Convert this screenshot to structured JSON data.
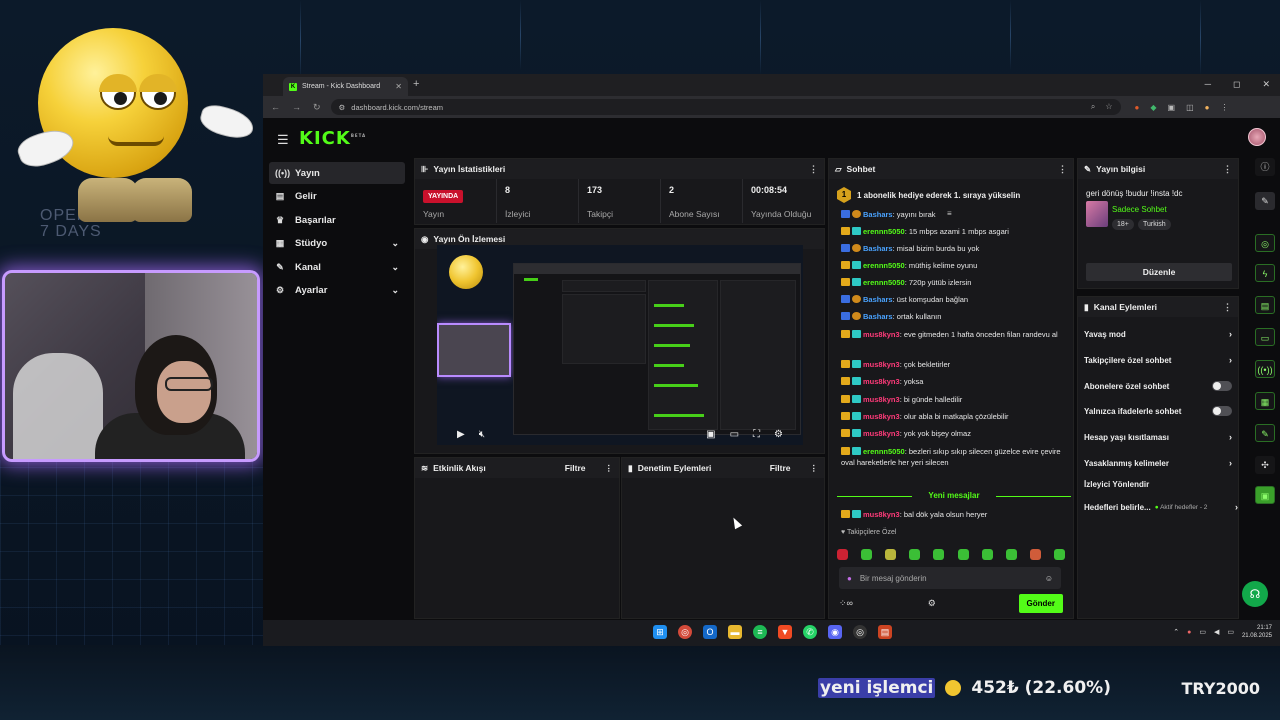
{
  "background": {
    "text": "OPEN\n7 DAYS"
  },
  "browser": {
    "tab_title": "Stream - Kick Dashboard",
    "url": "dashboard.kick.com/stream"
  },
  "app": {
    "logo": "KICK",
    "logo_badge": "BETA",
    "nav": [
      {
        "label": "Yayın",
        "icon": "broadcast-icon"
      },
      {
        "label": "Gelir",
        "icon": "wallet-icon"
      },
      {
        "label": "Başarılar",
        "icon": "trophy-icon"
      },
      {
        "label": "Stüdyo",
        "icon": "studio-icon"
      },
      {
        "label": "Kanal",
        "icon": "channel-icon"
      },
      {
        "label": "Ayarlar",
        "icon": "settings-icon"
      }
    ]
  },
  "stats_panel": {
    "title": "Yayın İstatistikleri",
    "live_badge": "YAYINDA",
    "stats": [
      {
        "value": "",
        "label": "Yayın"
      },
      {
        "value": "8",
        "label": "İzleyici"
      },
      {
        "value": "173",
        "label": "Takipçi"
      },
      {
        "value": "2",
        "label": "Abone Sayısı"
      },
      {
        "value": "00:08:54",
        "label": "Yayında Olduğu"
      }
    ]
  },
  "preview_panel": {
    "title": "Yayın Ön İzlemesi"
  },
  "activity_panel": {
    "title": "Etkinlik Akışı",
    "filter": "Filtre"
  },
  "moderation_panel": {
    "title": "Denetim Eylemleri",
    "filter": "Filtre"
  },
  "chat": {
    "title": "Sohbet",
    "pinned": "1 abonelik hediye ederek 1. sıraya yükselin",
    "pinned_number": "1",
    "messages": [
      {
        "user": "Bashars",
        "text": ": yayını bırak",
        "color": "blue"
      },
      {
        "user": "erennn5050",
        "text": ": 15 mbps azami 1 mbps asgari",
        "color": "green"
      },
      {
        "user": "Bashars",
        "text": ": misal bizim burda bu yok",
        "color": "blue"
      },
      {
        "user": "erennn5050",
        "text": ": müthiş kelime oyunu",
        "color": "green"
      },
      {
        "user": "erennn5050",
        "text": ": 720p yütüb izlersin",
        "color": "green"
      },
      {
        "user": "Bashars",
        "text": ": üst komşudan bağlan",
        "color": "blue"
      },
      {
        "user": "Bashars",
        "text": ": ortak kullanın",
        "color": "blue"
      },
      {
        "user": "mus8kyn3",
        "text": ": eve gitmeden 1 hafta önceden filan randevu al",
        "color": "red"
      },
      {
        "user": "mus8kyn3",
        "text": ": çok bekletirler",
        "color": "red"
      },
      {
        "user": "mus8kyn3",
        "text": ": yoksa",
        "color": "red"
      },
      {
        "user": "mus8kyn3",
        "text": ": bi günde halledilir",
        "color": "red"
      },
      {
        "user": "mus8kyn3",
        "text": ": olur abla bi matkapla çözülebilir",
        "color": "red"
      },
      {
        "user": "mus8kyn3",
        "text": ": yok yok bişey olmaz",
        "color": "red"
      },
      {
        "user": "erennn5050",
        "text": ": bezleri sıkıp sıkıp silecen güzelce evire çevire oval hareketlerle her yeri silecen",
        "color": "green"
      }
    ],
    "new_messages": "Yeni mesajlar",
    "last_message": {
      "user": "mus8kyn3",
      "text": ": bal dök yala olsun heryer"
    },
    "followers_only": "Takipçilere Özel",
    "input_placeholder": "Bir mesaj gönderin",
    "send": "Gönder"
  },
  "stream_info": {
    "title": "Yayın bilgisi",
    "stream_title": "geri dönüş !budur !insta !dc",
    "category": "Sadece Sohbet",
    "tags": [
      "18+",
      "Turkish"
    ],
    "edit": "Düzenle"
  },
  "channel_actions": {
    "title": "Kanal Eylemleri",
    "items": [
      {
        "label": "Yavaş mod",
        "type": "arrow"
      },
      {
        "label": "Takipçilere özel sohbet",
        "type": "arrow"
      },
      {
        "label": "Abonelere özel sohbet",
        "type": "toggle"
      },
      {
        "label": "Yalnızca ifadelerle sohbet",
        "type": "toggle"
      },
      {
        "label": "Hesap yaşı kısıtlaması",
        "type": "arrow"
      },
      {
        "label": "Yasaklanmış kelimeler",
        "type": "arrow"
      },
      {
        "label": "İzleyici Yönlendir",
        "type": "none"
      },
      {
        "label": "Hedefleri belirle...",
        "type": "goals"
      }
    ],
    "goals_sub": "Aktif hedefler - 2"
  },
  "taskbar": {
    "time": "21:17",
    "date": "21.08.2025"
  },
  "ticker": {
    "name": "yeni işlemci",
    "change": "452₺ (22.60%)",
    "price": "TRY2000"
  },
  "colors": {
    "kick_green": "#53fc18",
    "live_red": "#c9112c",
    "cam_border": "#c79bff"
  }
}
